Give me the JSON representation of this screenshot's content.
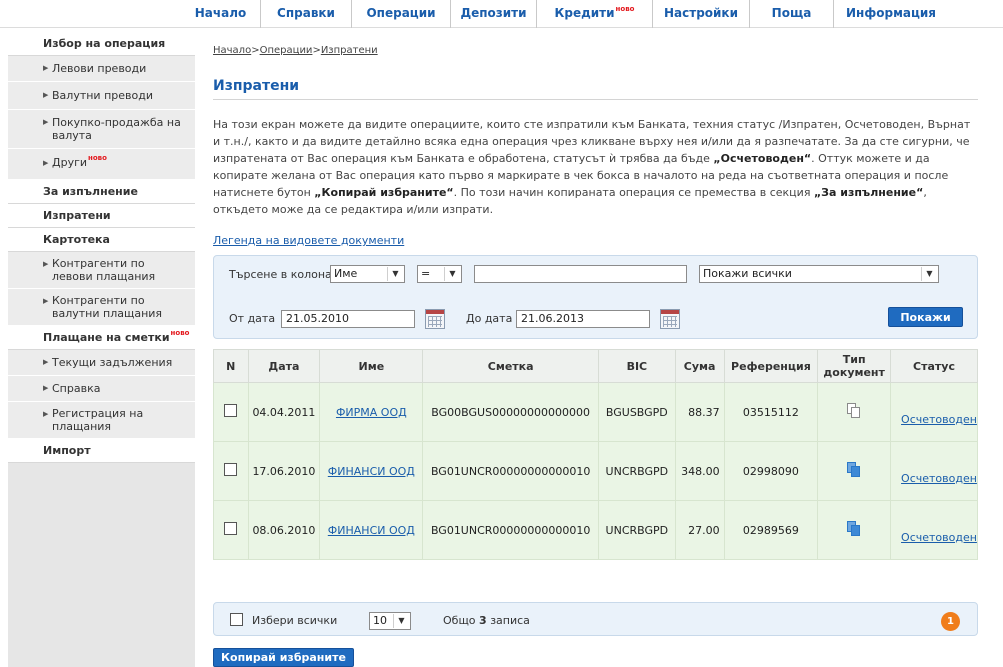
{
  "topnav": {
    "items": [
      "Начало",
      "Справки",
      "Операции",
      "Депозити",
      "Кредити",
      "Настройки",
      "Поща",
      "Информация"
    ],
    "new_badge": "ново"
  },
  "sidebar": {
    "choose_operation": "Избор на операция",
    "choose_items": [
      "Левови преводи",
      "Валутни преводи",
      "Покупко-продажба на валута",
      "Други"
    ],
    "for_execution": "За изпълнение",
    "sent": "Изпратени",
    "cards": "Картотека",
    "cards_items": [
      "Контрагенти по левови плащания",
      "Контрагенти по валутни плащания"
    ],
    "bill_payment": "Плащане на сметки",
    "bill_items": [
      "Текущи задължения",
      "Справка",
      "Регистрация на плащания"
    ],
    "import": "Импорт"
  },
  "breadcrumb": {
    "home": "Начало",
    "operations": "Операции",
    "sent": "Изпратени",
    "sep": ">"
  },
  "page": {
    "title": "Изпратени",
    "desc_1": "На този екран можете да видите операциите, които сте изпратили към Банката, техния статус /Изпратен, Осчетоводен, Върнат и т.н./, както и да видите детайлно всяка една операция чрез кликване върху нея и/или да я разпечатате. За да сте сигурни, че изпратената от Вас операция към Банката е обработена, статусът ѝ трябва да бъде ",
    "desc_b1": "„Осчетоводен“",
    "desc_2": ". Оттук можете и да копирате желана от Вас операция като първо я маркирате в чек бокса в началото на реда на съответната операция и после натиснете бутон ",
    "desc_b2": "„Копирай избраните“",
    "desc_3": ". По този начин копираната операция се премества в секция ",
    "desc_b3": "„За изпълнение“",
    "desc_4": ", откъдето може да се редактира и/или изпрати.",
    "legend_link": "Легенда на видовете документи"
  },
  "filter": {
    "search_label": "Търсене в колона",
    "column_value": "Име",
    "operator_value": "=",
    "search_value": "",
    "show_value": "Покажи всички",
    "from_label": "От дата",
    "from_value": "21.05.2010",
    "to_label": "До дата",
    "to_value": "21.06.2013",
    "show_button": "Покажи"
  },
  "table": {
    "headers": [
      "N",
      "Дата",
      "Име",
      "Сметка",
      "BIC",
      "Сума",
      "Референция",
      "Тип документ",
      "Статус"
    ],
    "rows": [
      {
        "date": "04.04.2011",
        "name": "ФИРМА ООД",
        "account": "BG00BGUS00000000000000",
        "bic": "BGUSBGPD",
        "amount": "88.37",
        "reference": "03515112",
        "doc_icon": "document-grey-icon",
        "status": "Осчетоводен"
      },
      {
        "date": "17.06.2010",
        "name": "ФИНАНСИ ООД",
        "account": "BG01UNCR00000000000010",
        "bic": "UNCRBGPD",
        "amount": "348.00",
        "reference": "02998090",
        "doc_icon": "document-blue-icon",
        "status": "Осчетоводен"
      },
      {
        "date": "08.06.2010",
        "name": "ФИНАНСИ ООД",
        "account": "BG01UNCR00000000000010",
        "bic": "UNCRBGPD",
        "amount": "27.00",
        "reference": "02989569",
        "doc_icon": "document-blue-icon",
        "status": "Осчетоводен"
      }
    ]
  },
  "footer": {
    "select_all": "Избери всички",
    "per_page": "10",
    "total_prefix": "Общо",
    "total_count": "3",
    "total_suffix": "записа",
    "page_number": "1",
    "copy_button": "Копирай избраните"
  },
  "colors": {
    "accent": "#1a5dab",
    "button": "#1f6bc0",
    "new_badge": "#e3181d",
    "page_badge": "#f07d1b",
    "row_bg": "#eaf5e5"
  }
}
